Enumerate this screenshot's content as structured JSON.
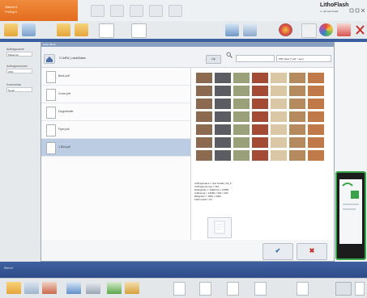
{
  "header": {
    "tab_title": "Stencil A",
    "tab_subtitle": "Preflight",
    "brand_name": "LithoFlash",
    "brand_sub": "c • all new rfsolsf",
    "icons": [
      "doc-icon",
      "doc-icon",
      "doc-icon",
      "doc-icon",
      "doc-icon"
    ]
  },
  "toolbar": {
    "icons": [
      "folder-open-icon",
      "image-add-icon",
      "folder-icon",
      "folder-icon",
      "document-icon",
      "document-icon",
      "page-icon",
      "network-icon",
      "chart-icon",
      "palette-icon",
      "zoom-icon",
      "color-wheel-icon",
      "edit-icon",
      "close-icon"
    ]
  },
  "left_panel": {
    "label1": "Auftragsname",
    "value1": "Plakat A2",
    "label2": "Auftragsnummer",
    "value2": "2301",
    "label3": "Kommentar",
    "value3": "Neuer"
  },
  "dialog": {
    "title": "Datei öffnen",
    "path": "C:\\ARW_Lokal\\Daten",
    "up_label": "Up",
    "filter": "PDF Files (*.pdf, *.eps)",
    "files": [
      {
        "name": "Beck.pdf"
      },
      {
        "name": "Cover.pdf"
      },
      {
        "name": "Doppelseite"
      },
      {
        "name": "Flyer.pdf"
      },
      {
        "name": "1 Bild.pdf"
      }
    ],
    "selected_index": 4,
    "info": [
      "Auftragsname = test.Gradel_A2_3",
      "Auftragsnummer = 001",
      "Dateigröße = 14962 kb x 14582",
      "Auflösung = 14990 x 300 x 300",
      "Bildgröße = 1000 x 1000",
      "Farbmodell = A1"
    ],
    "ok_symbol": "✔",
    "cancel_symbol": "✖"
  },
  "bottom": {
    "status": "Stencil"
  },
  "colors": {
    "accent_orange": "#e8742a",
    "accent_blue": "#3c5fa0",
    "selection": "#bccde3",
    "device_border": "#3aa34a"
  }
}
